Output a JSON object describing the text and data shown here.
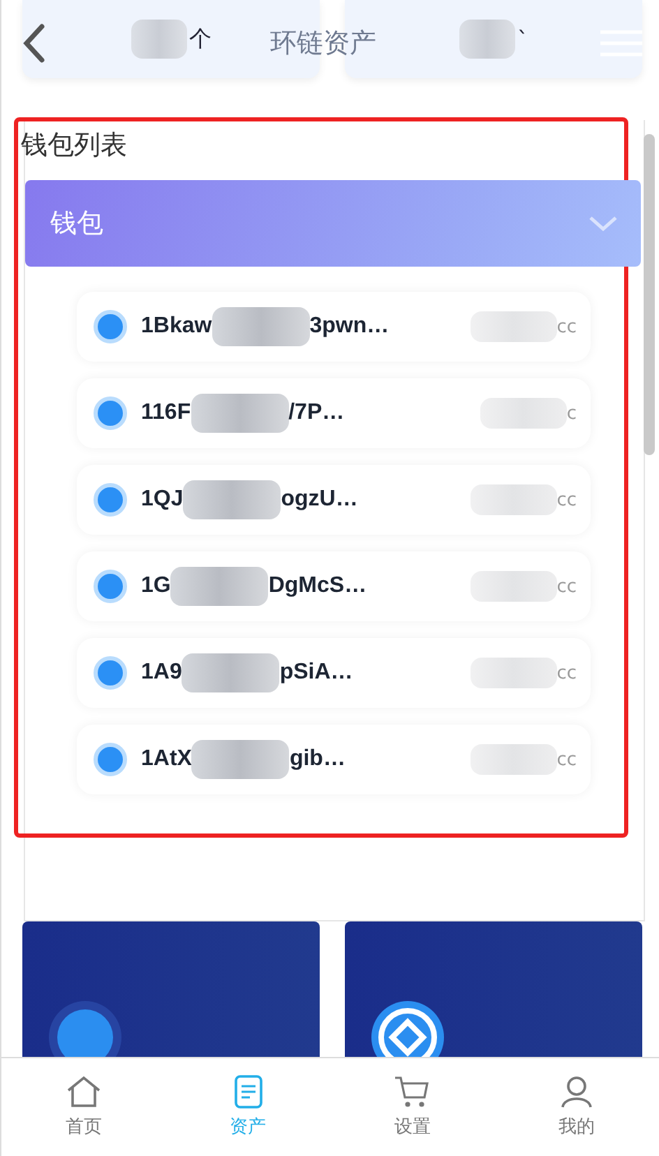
{
  "header": {
    "title": "环链资产",
    "top_cards": [
      {
        "text": "个"
      },
      {
        "text": "`"
      }
    ]
  },
  "section_title": "钱包列表",
  "wallet_group": {
    "title": "钱包",
    "expanded": true,
    "items": [
      {
        "address_start": "1Bkaw",
        "address_end": "3pwn…",
        "amount_end": "cc"
      },
      {
        "address_start": "116F",
        "address_end": "/7P…",
        "amount_end": "c"
      },
      {
        "address_start": "1QJ",
        "address_end": "ogzU…",
        "amount_end": "cc"
      },
      {
        "address_start": "1G",
        "address_end": "DgMcS…",
        "amount_end": "cc"
      },
      {
        "address_start": "1A9",
        "address_end": "pSiA…",
        "amount_end": "cc"
      },
      {
        "address_start": "1AtX",
        "address_end": "gib…",
        "amount_end": "cc"
      }
    ]
  },
  "coin_cards": [
    {
      "kind": "dot"
    },
    {
      "kind": "diamond"
    }
  ],
  "tabs": [
    {
      "label": "首页",
      "kind": "home",
      "selected": false
    },
    {
      "label": "资产",
      "kind": "document",
      "selected": true
    },
    {
      "label": "设置",
      "kind": "cart",
      "selected": false
    },
    {
      "label": "我的",
      "kind": "user",
      "selected": false
    }
  ]
}
